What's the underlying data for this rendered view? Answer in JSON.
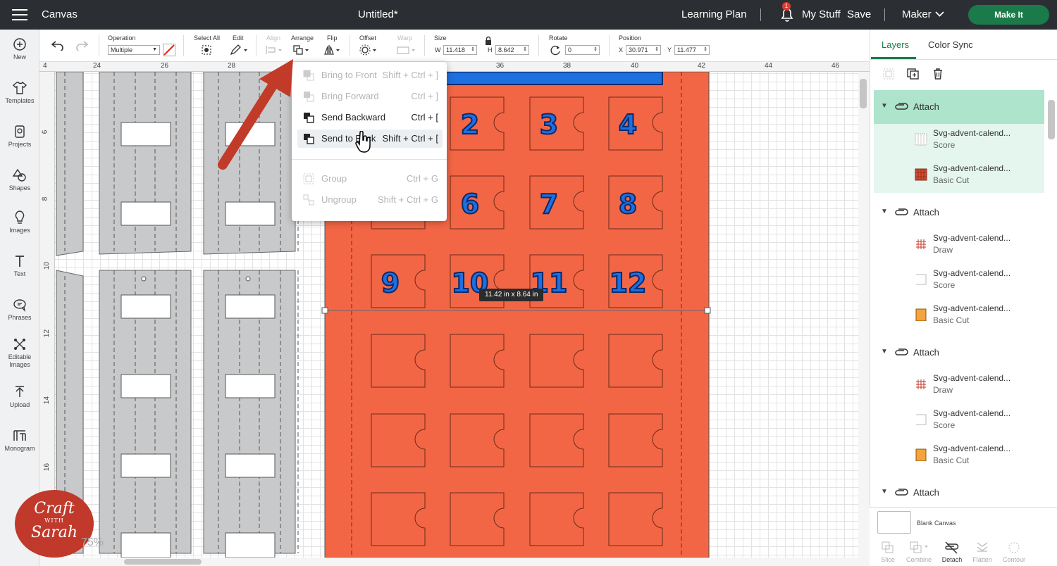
{
  "app": {
    "title": "Canvas",
    "doc_title": "Untitled*"
  },
  "header": {
    "learning_plan": "Learning Plan",
    "notifications": "1",
    "my_stuff": "My Stuff",
    "save": "Save",
    "machine": "Maker",
    "make_it": "Make It"
  },
  "sidebar": {
    "items": [
      {
        "label": "New",
        "icon": "plus-circle-icon"
      },
      {
        "label": "Templates",
        "icon": "shirt-icon"
      },
      {
        "label": "Projects",
        "icon": "projects-icon"
      },
      {
        "label": "Shapes",
        "icon": "shapes-icon"
      },
      {
        "label": "Images",
        "icon": "bulb-icon"
      },
      {
        "label": "Text",
        "icon": "text-icon"
      },
      {
        "label": "Phrases",
        "icon": "speech-bubble-icon"
      },
      {
        "label": "Editable",
        "label2": "Images",
        "icon": "editable-images-icon"
      },
      {
        "label": "Upload",
        "icon": "upload-icon"
      },
      {
        "label": "Monogram",
        "icon": "monogram-icon"
      }
    ]
  },
  "toolbar": {
    "operation_label": "Operation",
    "operation_value": "Multiple",
    "select_all": "Select All",
    "edit": "Edit",
    "align": "Align",
    "arrange": "Arrange",
    "flip": "Flip",
    "offset": "Offset",
    "warp": "Warp",
    "size": "Size",
    "w_label": "W",
    "w_value": "11.418",
    "h_label": "H",
    "h_value": "8.642",
    "rotate": "Rotate",
    "rotate_value": "0",
    "position": "Position",
    "x_label": "X",
    "x_value": "30.971",
    "y_label": "Y",
    "y_value": "11.477"
  },
  "ruler": {
    "top": [
      "24",
      "26",
      "28",
      "36",
      "38",
      "40",
      "42",
      "44",
      "46"
    ],
    "left": [
      "6",
      "8",
      "10",
      "12",
      "14",
      "16"
    ],
    "partial": "4"
  },
  "arrange_menu": {
    "items": [
      {
        "label": "Bring to Front",
        "shortcut": "Shift + Ctrl + ]",
        "enabled": false
      },
      {
        "label": "Bring Forward",
        "shortcut": "Ctrl + ]",
        "enabled": false
      },
      {
        "label": "Send Backward",
        "shortcut": "Ctrl + [",
        "enabled": true
      },
      {
        "label": "Send to Back",
        "shortcut": "Shift + Ctrl + [",
        "enabled": true,
        "hovered": true
      },
      {
        "label": "Group",
        "shortcut": "Ctrl + G",
        "enabled": false
      },
      {
        "label": "Ungroup",
        "shortcut": "Shift + Ctrl + G",
        "enabled": false
      }
    ]
  },
  "canvas": {
    "numbers": [
      "2",
      "3",
      "4",
      "6",
      "7",
      "8",
      "9",
      "10",
      "11",
      "12"
    ],
    "size_tooltip": "11.42  in x 8.64  in",
    "zoom": "75%",
    "colors": {
      "orange": "#f26645",
      "blue_number": "#1e6fe0",
      "gray_piece": "#c8c9cb"
    }
  },
  "layers_panel": {
    "tabs": [
      "Layers",
      "Color Sync"
    ],
    "groups": [
      {
        "name": "Attach",
        "selected": true,
        "children": [
          {
            "name": "Svg-advent-calend...",
            "type": "Score"
          },
          {
            "name": "Svg-advent-calend...",
            "type": "Basic Cut"
          }
        ]
      },
      {
        "name": "Attach",
        "children": [
          {
            "name": "Svg-advent-calend...",
            "type": "Draw"
          },
          {
            "name": "Svg-advent-calend...",
            "type": "Score"
          },
          {
            "name": "Svg-advent-calend...",
            "type": "Basic Cut"
          }
        ]
      },
      {
        "name": "Attach",
        "children": [
          {
            "name": "Svg-advent-calend...",
            "type": "Draw"
          },
          {
            "name": "Svg-advent-calend...",
            "type": "Score"
          },
          {
            "name": "Svg-advent-calend...",
            "type": "Basic Cut"
          }
        ]
      },
      {
        "name": "Attach",
        "children": []
      }
    ],
    "blank_canvas": "Blank Canvas",
    "bottom_tools": [
      "Slice",
      "Combine",
      "Detach",
      "Flatten",
      "Contour"
    ]
  },
  "logo": {
    "text1": "Craft",
    "text2": "WITH",
    "text3": "Sarah"
  }
}
